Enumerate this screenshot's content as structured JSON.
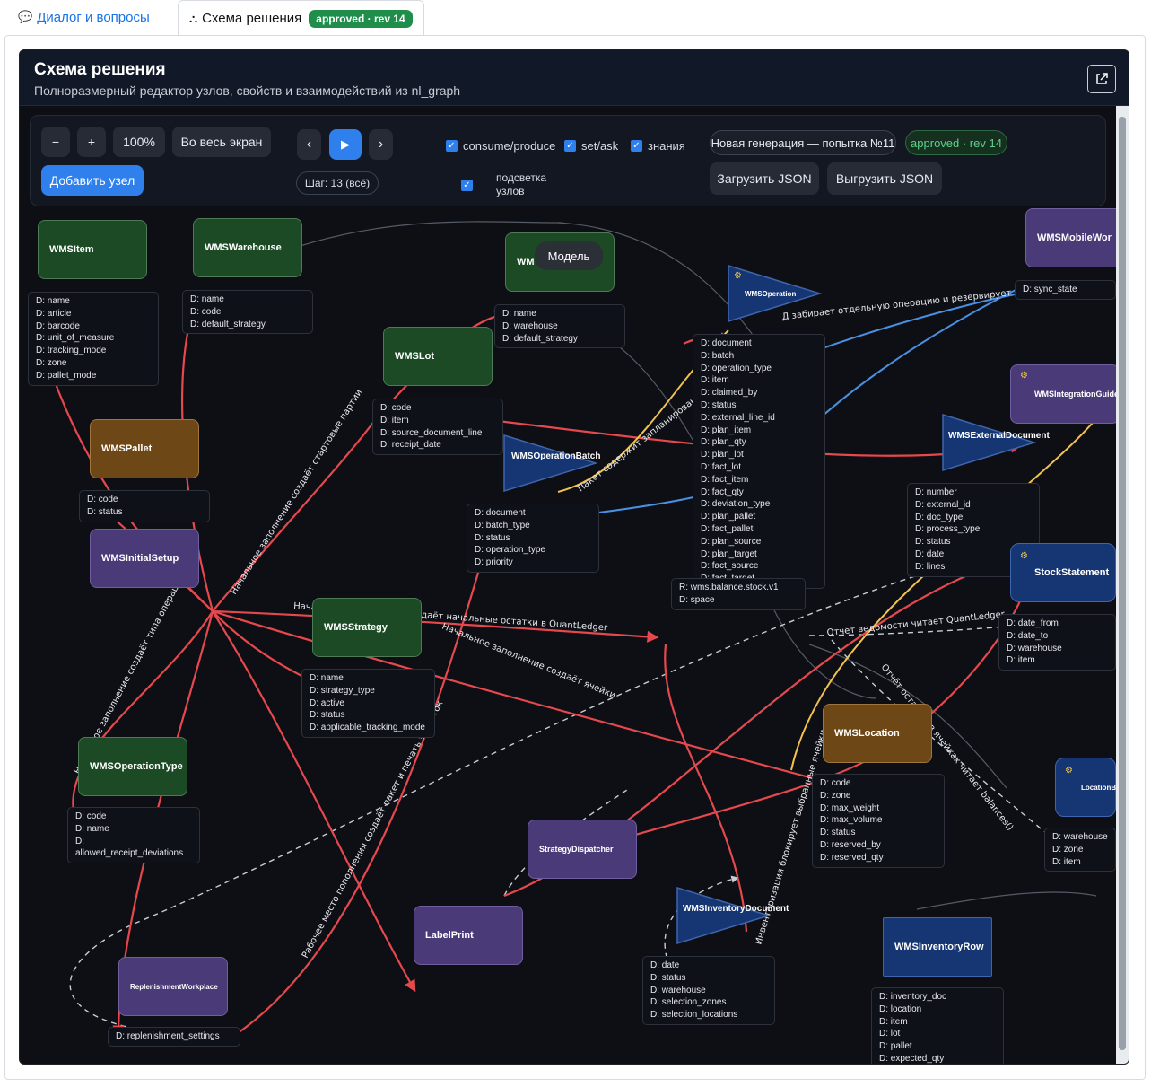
{
  "tabs": {
    "dialog": "Диалог и вопросы",
    "scheme": "Схема решения",
    "scheme_badge": "approved · rev 14"
  },
  "panel": {
    "title": "Схема решения",
    "subtitle": "Полноразмерный редактор узлов, свойств и взаимодействий из nl_graph"
  },
  "toolbar": {
    "zoom_out": "−",
    "zoom_in": "+",
    "zoom_level": "100%",
    "fullscreen": "Во весь экран",
    "add_node": "Добавить узел",
    "prev": "‹",
    "play": "▶",
    "next": "›",
    "step": "Шаг: 13 (всё)",
    "chk_consume": "consume/produce",
    "chk_setask": "set/ask",
    "chk_knowledge": "знания",
    "chk_highlight": "подсветка узлов",
    "generation": "Новая генерация — попытка №11",
    "gen_status": "approved · rev 14",
    "load_json": "Загрузить JSON",
    "export_json": "Выгрузить JSON"
  },
  "tooltip": "Модель",
  "colors": {
    "accent": "#2f80ed",
    "approved": "#1e8e4a",
    "edge": "#e5484d",
    "edge_blue": "#4a90e2",
    "edge_yellow": "#f2c14e"
  },
  "nodes": {
    "wmsitem": {
      "label": "WMSItem",
      "props": [
        "D: name",
        "D: article",
        "D: barcode",
        "D: unit_of_measure",
        "D: tracking_mode",
        "D: zone",
        "D: pallet_mode"
      ]
    },
    "wmswarehouse": {
      "label": "WMSWarehouse",
      "props": [
        "D: name",
        "D: code",
        "D: default_strategy"
      ]
    },
    "model": {
      "label": "WM",
      "props": [
        "D: name",
        "D: warehouse",
        "D: default_strategy"
      ]
    },
    "wmslot": {
      "label": "WMSLot",
      "props": [
        "D: code",
        "D: item",
        "D: source_document_line",
        "D: receipt_date"
      ]
    },
    "wmspallet": {
      "label": "WMSPallet",
      "props": [
        "D: code",
        "D: status"
      ]
    },
    "wmsinitialsetup": {
      "label": "WMSInitialSetup"
    },
    "wmsoperationbatch": {
      "label": "WMSOperationBatch",
      "props": [
        "D: document",
        "D: batch_type",
        "D: status",
        "D: operation_type",
        "D: priority"
      ]
    },
    "wmsoperation": {
      "label": "WMSOperation",
      "props": [
        "D: document",
        "D: batch",
        "D: operation_type",
        "D: item",
        "D: claimed_by",
        "D: status",
        "D: external_line_id",
        "D: plan_item",
        "D: plan_qty",
        "D: plan_lot",
        "D: fact_lot",
        "D: fact_item",
        "D: fact_qty",
        "D: deviation_type",
        "D: plan_pallet",
        "D: fact_pallet",
        "D: plan_source",
        "D: plan_target",
        "D: fact_source",
        "D: fact_target"
      ]
    },
    "quantledger_props": [
      "R: wms.balance.stock.v1",
      "D: space"
    ],
    "wmsmobile": {
      "label": "WMSMobileWor",
      "props": [
        "D: sync_state"
      ]
    },
    "wmsintegration": {
      "label": "WMSIntegrationGuide"
    },
    "wmsexternal": {
      "label": "WMSExternalDocument",
      "props": [
        "D: number",
        "D: external_id",
        "D: doc_type",
        "D: process_type",
        "D: status",
        "D: date",
        "D: lines"
      ]
    },
    "stockstatement": {
      "label": "StockStatement",
      "props": [
        "D: date_from",
        "D: date_to",
        "D: warehouse",
        "D: item"
      ]
    },
    "wmsstrategy": {
      "label": "WMSStrategy",
      "props": [
        "D: name",
        "D: strategy_type",
        "D: active",
        "D: status",
        "D: applicable_tracking_mode"
      ]
    },
    "wmsoperationtype": {
      "label": "WMSOperationType",
      "props": [
        "D: code",
        "D: name",
        "D: allowed_receipt_deviations"
      ]
    },
    "wmslocation": {
      "label": "WMSLocation",
      "props": [
        "D: code",
        "D: zone",
        "D: max_weight",
        "D: max_volume",
        "D: status",
        "D: reserved_by",
        "D: reserved_qty"
      ]
    },
    "locationbalance": {
      "label": "LocationBa",
      "props": [
        "D: warehouse",
        "D: zone",
        "D: item"
      ]
    },
    "strategydispatcher": {
      "label": "StrategyDispatcher"
    },
    "labelprint": {
      "label": "LabelPrint"
    },
    "wmsinventorydoc": {
      "label": "WMSInventoryDocument",
      "props": [
        "D: date",
        "D: status",
        "D: warehouse",
        "D: selection_zones",
        "D: selection_locations"
      ]
    },
    "wmsinventoryrow": {
      "label": "WMSInventoryRow",
      "props": [
        "D: inventory_doc",
        "D: location",
        "D: item",
        "D: lot",
        "D: pallet",
        "D: expected_qty"
      ]
    },
    "replenishment": {
      "label": "ReplenishmentWorkplace",
      "props": [
        "D: replenishment_settings"
      ]
    }
  },
  "edge_labels": {
    "e1": "Начальное заполнение создаёт начальные остатки в QuantLedger",
    "e2": "Начальное заполнение создаёт ячейки",
    "e3": "Начальное заполнение создаёт стартовые партии",
    "e4": "Пакет содержит запланированные операции",
    "e5": "Отчёт остатков в ячейках читает balances()",
    "e6": "Отчёт ведомости читает QuantLedger",
    "e7": "Начальное заполнение создаёт типа операций",
    "e8": "Рабочее место пополнения создаёт пакет и печать этикеток",
    "e9": "Инвентаризация блокирует выбранные ячейки",
    "e10": "Д забирает отдельную операцию и резервирует её ячейки"
  }
}
